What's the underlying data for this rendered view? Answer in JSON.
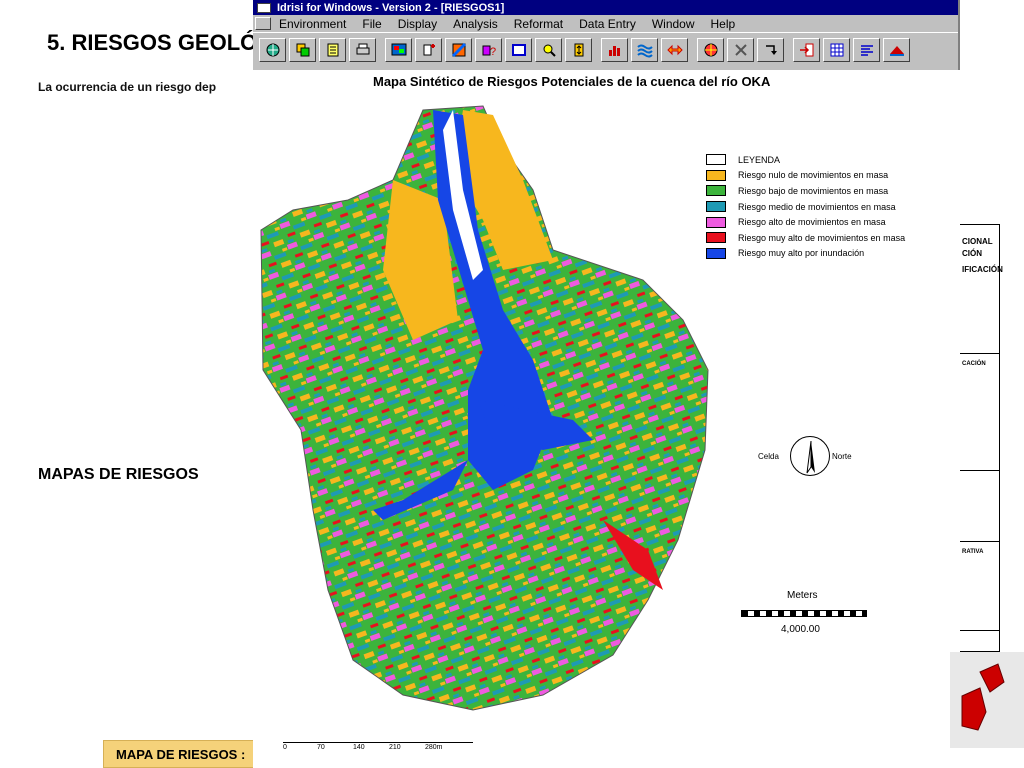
{
  "slide": {
    "title": "5. RIESGOS GEOLÓG",
    "body": "La ocurrencia de un riesgo dep",
    "subtitle": "MAPAS DE RIESGOS",
    "caption": "MAPA DE RIESGOS :"
  },
  "window": {
    "title": "Idrisi for Windows  -  Version 2 - [RIESGOS1]",
    "menus": [
      "Environment",
      "File",
      "Display",
      "Analysis",
      "Reformat",
      "Data Entry",
      "Window",
      "Help"
    ]
  },
  "map": {
    "title": "Mapa Sintético de Riesgos Potenciales de la cuenca del río OKA",
    "legend": [
      {
        "label": "LEYENDA",
        "color": "#ffffff"
      },
      {
        "label": "Riesgo nulo de movimientos en masa",
        "color": "#f7b71e"
      },
      {
        "label": "Riesgo bajo de movimientos en masa",
        "color": "#3cb43c"
      },
      {
        "label": "Riesgo medio de movimientos en masa",
        "color": "#1e9ab4"
      },
      {
        "label": "Riesgo alto de movimientos en masa",
        "color": "#ee5be0"
      },
      {
        "label": "Riesgo muy alto de movimientos en masa",
        "color": "#e8101e"
      },
      {
        "label": "Riesgo muy alto por inundación",
        "color": "#1646e6"
      }
    ],
    "compass": {
      "left": "Celda",
      "right": "Norte"
    },
    "scale": {
      "units": "Meters",
      "distance": "4,000.00"
    },
    "bottom_ticks": [
      "0",
      "70",
      "140",
      "210",
      "280m"
    ]
  },
  "side_doc": {
    "heading1": "CIONAL",
    "heading2": "CIÓN",
    "heading3": "IFICACIÓN",
    "section1": "CACIÓN",
    "section2": "RATIVA"
  }
}
